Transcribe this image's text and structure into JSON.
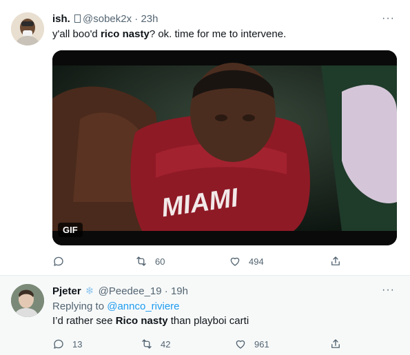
{
  "tweet": {
    "author_name": "ish.",
    "handle": "@sobek2x",
    "separator": "·",
    "time": "23h",
    "more_glyph": "···",
    "text_before": "y'all boo'd ",
    "text_bold": "rico nasty",
    "text_after": "? ok. time for me to intervene.",
    "media_badge": "GIF",
    "jersey_text": "MIAMI",
    "reply_count": "",
    "retweet_count": "60",
    "like_count": "494",
    "icons": [
      "reply-icon",
      "retweet-icon",
      "like-icon",
      "share-icon"
    ]
  },
  "reply": {
    "author_name": "Pjeter",
    "badge_icon": "snowflake-icon",
    "handle": "@Peedee_19",
    "separator": "·",
    "time": "19h",
    "more_glyph": "···",
    "replying_prefix": "Replying to ",
    "replying_handle": "@annco_riviere",
    "text_before": "I’d rather see ",
    "text_bold": "Rico nasty",
    "text_after": " than playboi carti",
    "reply_count": "13",
    "retweet_count": "42",
    "like_count": "961"
  },
  "colors": {
    "text": "#0f1419",
    "muted": "#536471",
    "link": "#1d9bf0",
    "reply_background": "#f7f9f9",
    "jersey": "#8e1a26"
  }
}
